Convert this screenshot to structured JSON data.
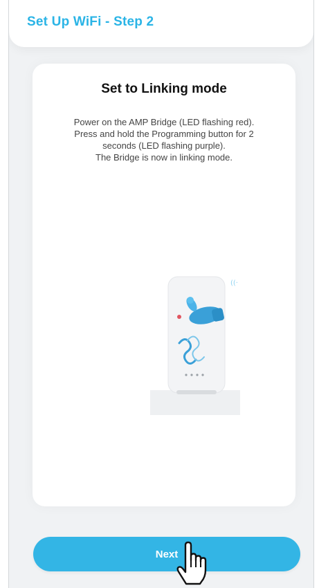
{
  "header": {
    "title": "Set Up WiFi - Step 2"
  },
  "card": {
    "title": "Set to Linking mode",
    "description_lines": [
      "Power on the AMP Bridge (LED flashing red).",
      "Press and hold the Programming button for 2",
      "seconds (LED flashing purple).",
      "The Bridge is now in linking mode."
    ],
    "illustration_icon": "bridge-device-press-icon"
  },
  "footer": {
    "next_label": "Next"
  },
  "colors": {
    "accent": "#33b5e5",
    "title_accent": "#2ab4e6",
    "screen_bg": "#f0f2f4"
  }
}
